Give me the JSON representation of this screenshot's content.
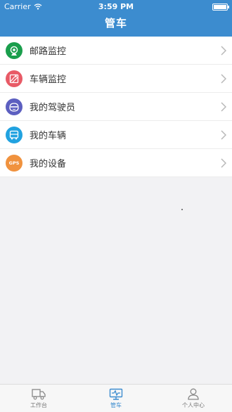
{
  "status_bar": {
    "carrier": "Carrier",
    "time": "3:59 PM"
  },
  "header": {
    "title": "管车"
  },
  "menu": {
    "items": [
      {
        "label": "邮路监控",
        "icon": "camera-icon",
        "color": "#1a9e4c"
      },
      {
        "label": "车辆监控",
        "icon": "map-icon",
        "color": "#e85a66"
      },
      {
        "label": "我的驾驶员",
        "icon": "driver-icon",
        "color": "#5c5fc0"
      },
      {
        "label": "我的车辆",
        "icon": "bus-icon",
        "color": "#21a2e0"
      },
      {
        "label": "我的设备",
        "icon": "gps-icon",
        "color": "#f0923e",
        "icon_text": "GPS"
      }
    ]
  },
  "tabbar": {
    "tabs": [
      {
        "label": "工作台",
        "icon": "truck-icon",
        "active": false
      },
      {
        "label": "管车",
        "icon": "monitor-icon",
        "active": true
      },
      {
        "label": "个人中心",
        "icon": "person-icon",
        "active": false
      }
    ]
  },
  "colors": {
    "primary": "#3c8ccf",
    "background": "#f2f2f4"
  }
}
